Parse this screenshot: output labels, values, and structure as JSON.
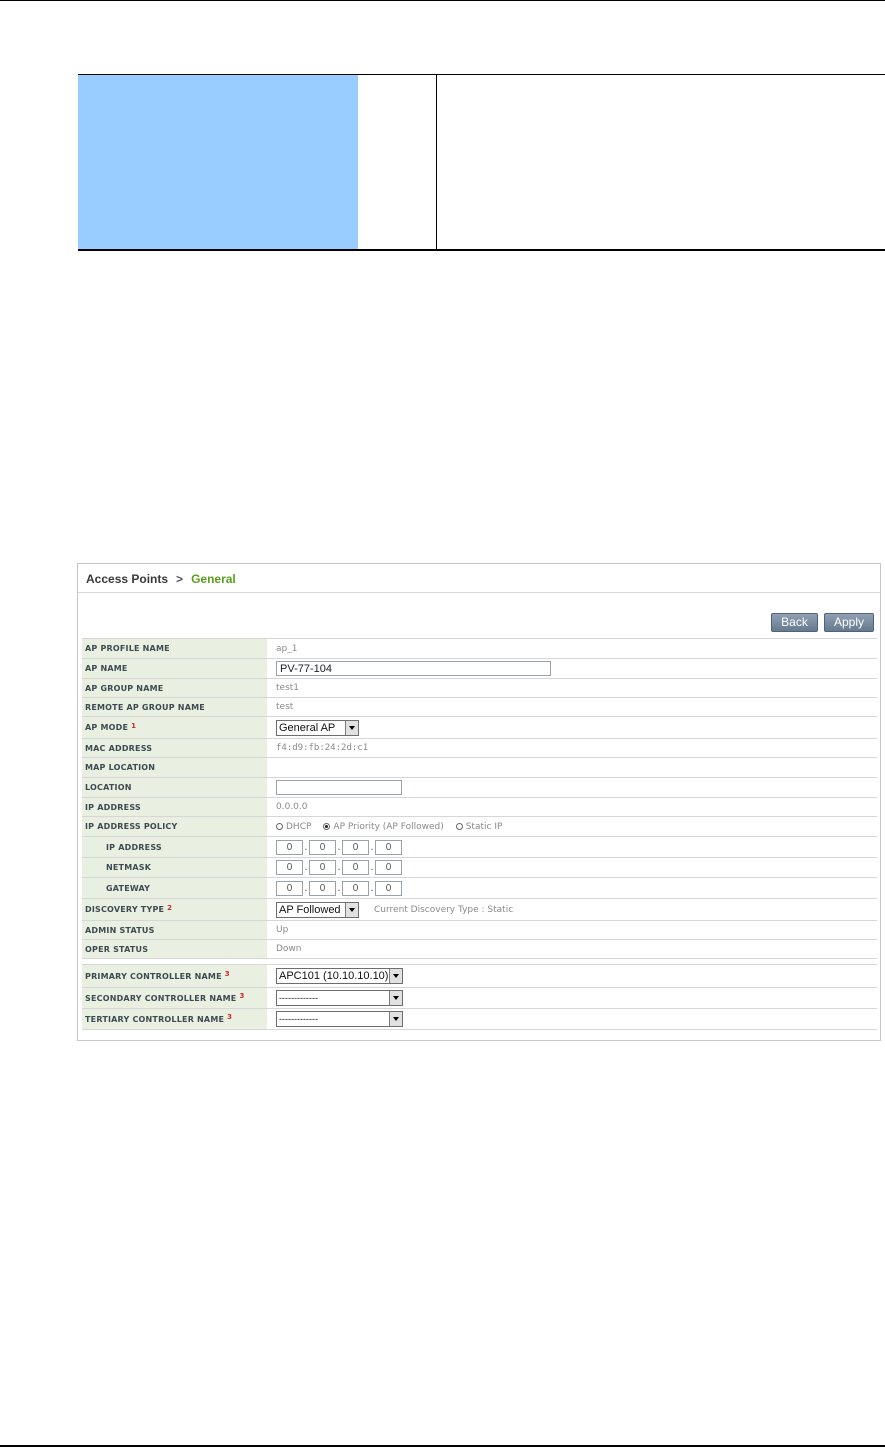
{
  "breadcrumb": {
    "root": "Access Points",
    "separator": ">",
    "current": "General"
  },
  "buttons": {
    "back": "Back",
    "apply": "Apply"
  },
  "fields": {
    "ap_profile_name": {
      "label": "AP PROFILE NAME",
      "value": "ap_1"
    },
    "ap_name": {
      "label": "AP NAME",
      "value": "PV-77-104"
    },
    "ap_group_name": {
      "label": "AP GROUP NAME",
      "value": "test1"
    },
    "remote_ap_group_name": {
      "label": "REMOTE AP GROUP NAME",
      "value": "test"
    },
    "ap_mode": {
      "label": "AP MODE",
      "note": "1",
      "value": "General AP"
    },
    "mac_address": {
      "label": "MAC ADDRESS",
      "value": "f4:d9:fb:24:2d:c1"
    },
    "map_location": {
      "label": "MAP LOCATION",
      "value": ""
    },
    "location": {
      "label": "LOCATION",
      "value": ""
    },
    "ip_address": {
      "label": "IP ADDRESS",
      "value": "0.0.0.0"
    },
    "ip_address_policy": {
      "label": "IP ADDRESS POLICY",
      "options": [
        "DHCP",
        "AP Priority (AP Followed)",
        "Static IP"
      ],
      "selected": "AP Priority (AP Followed)"
    },
    "static_ip": {
      "label": "IP ADDRESS",
      "octets": [
        "0",
        "0",
        "0",
        "0"
      ]
    },
    "netmask": {
      "label": "NETMASK",
      "octets": [
        "0",
        "0",
        "0",
        "0"
      ]
    },
    "gateway": {
      "label": "GATEWAY",
      "octets": [
        "0",
        "0",
        "0",
        "0"
      ]
    },
    "discovery_type": {
      "label": "DISCOVERY TYPE",
      "note": "2",
      "value": "AP Followed",
      "hint": "Current Discovery Type : Static"
    },
    "admin_status": {
      "label": "ADMIN STATUS",
      "value": "Up"
    },
    "oper_status": {
      "label": "OPER STATUS",
      "value": "Down"
    },
    "primary_controller": {
      "label": "PRIMARY CONTROLLER NAME",
      "note": "3",
      "value": "APC101 (10.10.10.10)"
    },
    "secondary_controller": {
      "label": "SECONDARY CONTROLLER NAME",
      "note": "3",
      "value": "-------------"
    },
    "tertiary_controller": {
      "label": "TERTIARY CONTROLLER NAME",
      "note": "3",
      "value": "-------------"
    }
  },
  "colors": {
    "label_bg": "#e9f0e1",
    "doc_highlight": "#99ccff",
    "breadcrumb_current": "#5a9e1d",
    "note": "#d12a2a"
  }
}
